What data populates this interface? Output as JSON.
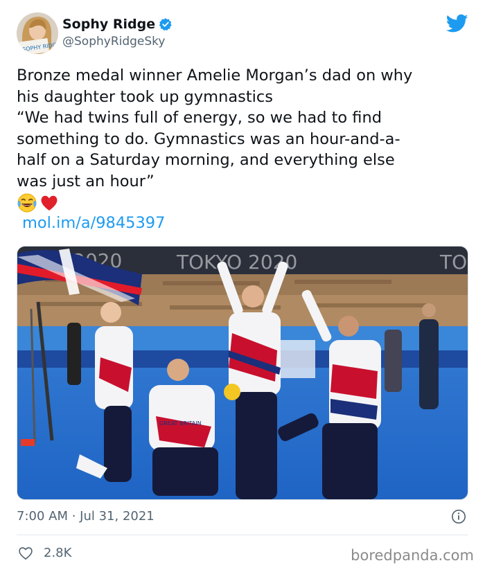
{
  "author": {
    "display_name": "Sophy Ridge",
    "handle": "@SophyRidgeSky",
    "avatar_sign_text": "SOPHY RIDGE",
    "verified": true
  },
  "tweet": {
    "lines": [
      "Bronze medal winner Amelie Morgan’s dad on why",
      "his daughter took up gymnastics",
      "“We had twins full of energy, so we had to find",
      "something to do. Gymnastics was an hour-and-a-",
      "half on a Saturday morning, and everything else",
      "was just an hour”"
    ],
    "emojis": [
      "crying-laughing-emoji",
      "red-heart-emoji"
    ],
    "link": "mol.im/a/9845397"
  },
  "photo": {
    "banner_texts": [
      "2020",
      "TOKYO 2020",
      "TO"
    ],
    "jersey_text": "GREAT BRITAIN"
  },
  "meta": {
    "timestamp": "7:00 AM · Jul 31, 2021",
    "likes": "2.8K"
  },
  "watermark": "boredpanda.com",
  "colors": {
    "accent": "#1d9bf0",
    "text_primary": "#0f1419",
    "text_secondary": "#536471",
    "divider": "#e1e8ed",
    "heart": "#f91880"
  }
}
